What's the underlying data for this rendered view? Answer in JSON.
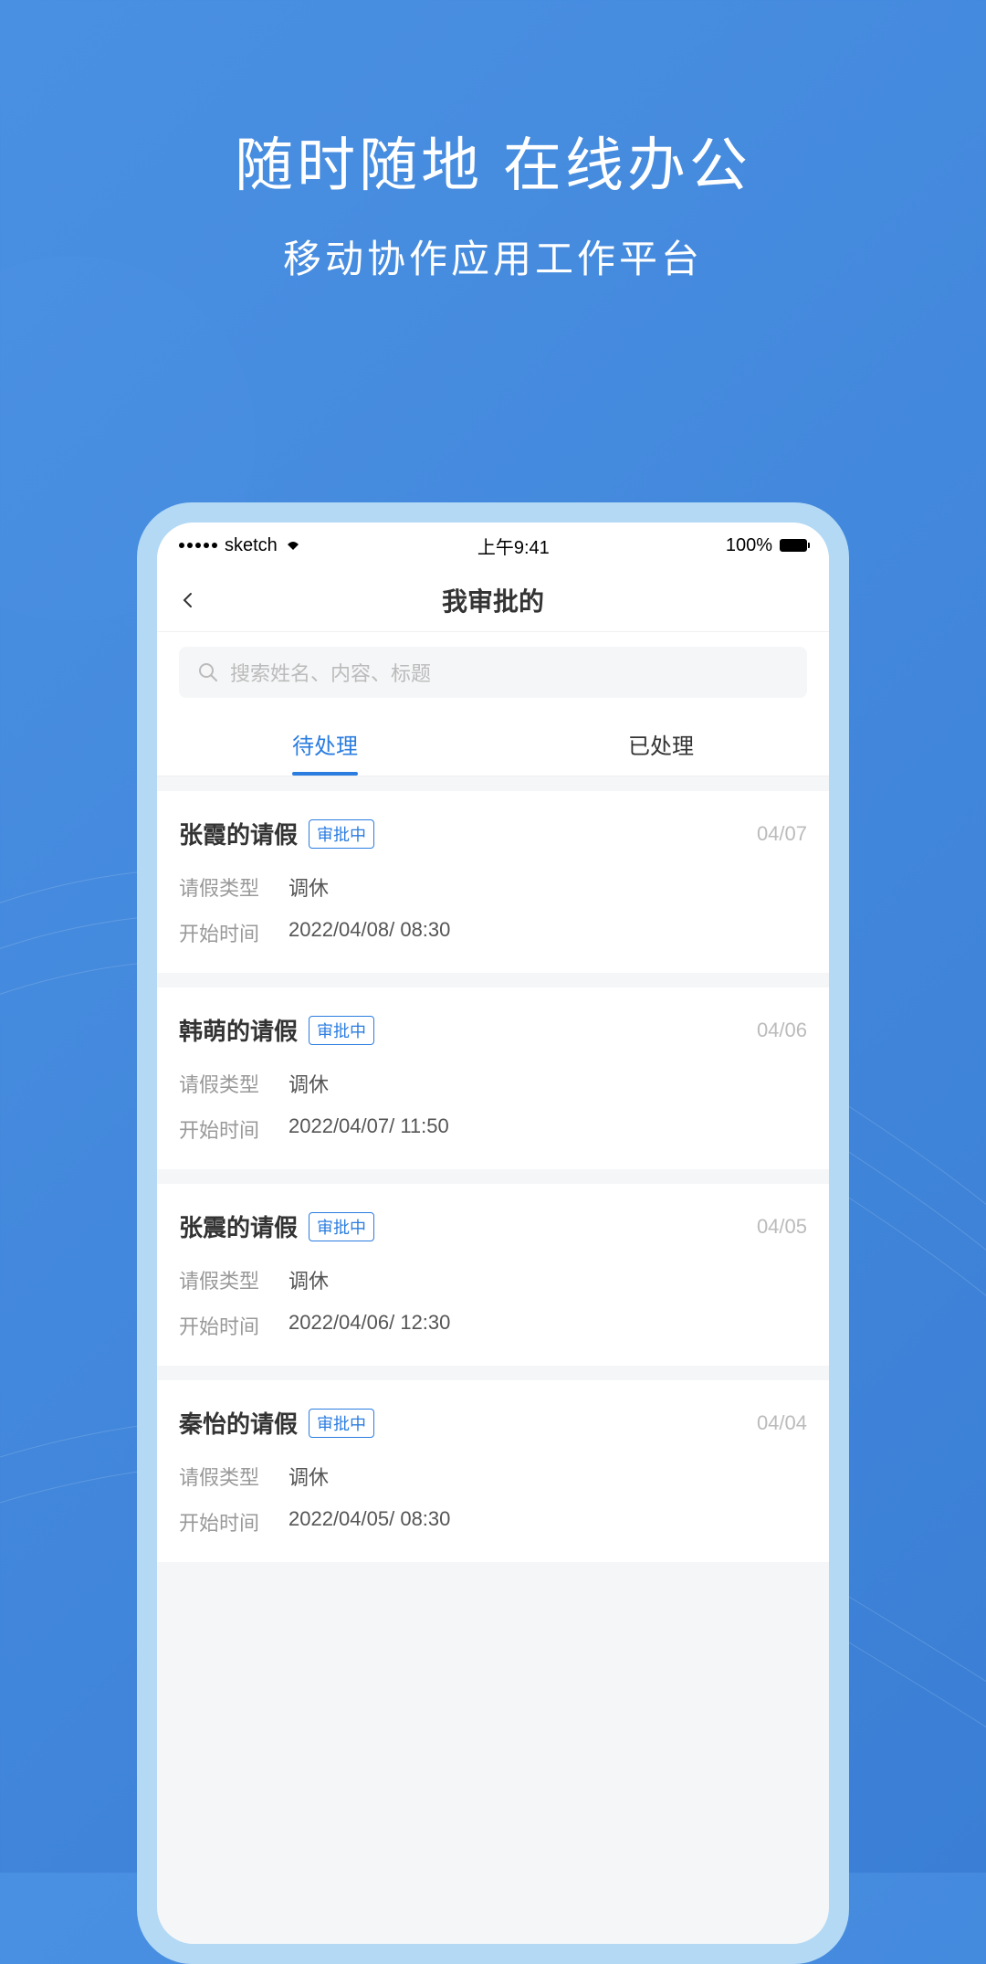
{
  "promo": {
    "title": "随时随地 在线办公",
    "subtitle": "移动协作应用工作平台"
  },
  "statusBar": {
    "carrier": "sketch",
    "time": "上午9:41",
    "battery": "100%"
  },
  "nav": {
    "title": "我审批的"
  },
  "search": {
    "placeholder": "搜索姓名、内容、标题"
  },
  "tabs": {
    "pending": "待处理",
    "processed": "已处理"
  },
  "labels": {
    "leaveType": "请假类型",
    "startTime": "开始时间",
    "statusBadge": "审批中"
  },
  "items": [
    {
      "title": "张霞的请假",
      "date": "04/07",
      "leaveType": "调休",
      "startTime": "2022/04/08/ 08:30"
    },
    {
      "title": "韩萌的请假",
      "date": "04/06",
      "leaveType": "调休",
      "startTime": "2022/04/07/ 11:50"
    },
    {
      "title": "张震的请假",
      "date": "04/05",
      "leaveType": "调休",
      "startTime": "2022/04/06/ 12:30"
    },
    {
      "title": "秦怡的请假",
      "date": "04/04",
      "leaveType": "调休",
      "startTime": "2022/04/05/ 08:30"
    }
  ]
}
